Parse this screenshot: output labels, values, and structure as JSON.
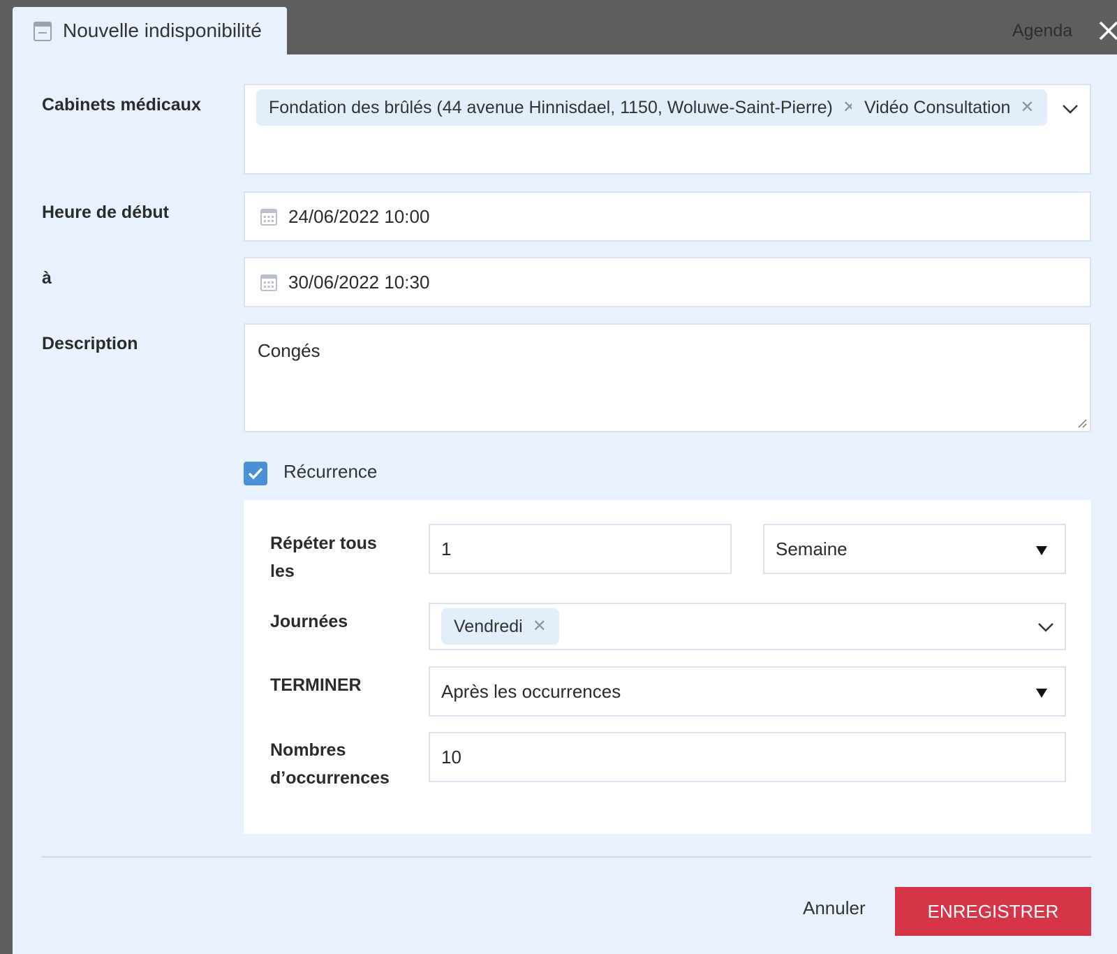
{
  "header": {
    "tab_title": "Nouvelle indisponibilité",
    "agenda_label": "Agenda"
  },
  "form": {
    "cabinets_label": "Cabinets médicaux",
    "cabinets_chips": [
      "Fondation des brûlés (44 avenue Hinnisdael, 1150, Woluwe-Saint-Pierre)",
      "Vidéo Consultation"
    ],
    "start_label": "Heure de début",
    "start_value": "24/06/2022 10:00",
    "end_label": "à",
    "end_value": "30/06/2022 10:30",
    "description_label": "Description",
    "description_value": "Congés",
    "recurrence_label": "Récurrence",
    "recurrence_checked": true
  },
  "recurrence": {
    "repeat_label_line1": "Répéter tous",
    "repeat_label_line2": "les",
    "repeat_value": "1",
    "repeat_unit": "Semaine",
    "days_label": "Journées",
    "days_chips": [
      "Vendredi"
    ],
    "end_label": "TERMINER",
    "end_value": "Après les occurrences",
    "count_label_line1": "Nombres",
    "count_label_line2": "d’occurrences",
    "count_value": "10"
  },
  "footer": {
    "cancel_label": "Annuler",
    "save_label": "ENREGISTRER"
  },
  "colors": {
    "panel_bg": "#e8f1fd",
    "header_bg": "#5e5e5e",
    "accent_blue": "#4a8fd9",
    "save_red": "#d63447"
  },
  "icons": {
    "tab": "calendar-icon",
    "close": "close-icon",
    "date": "calendar-icon",
    "chip_remove": "close-icon",
    "dropdown": "chevron-down-icon",
    "select": "triangle-down-icon",
    "checkbox": "check-icon"
  }
}
